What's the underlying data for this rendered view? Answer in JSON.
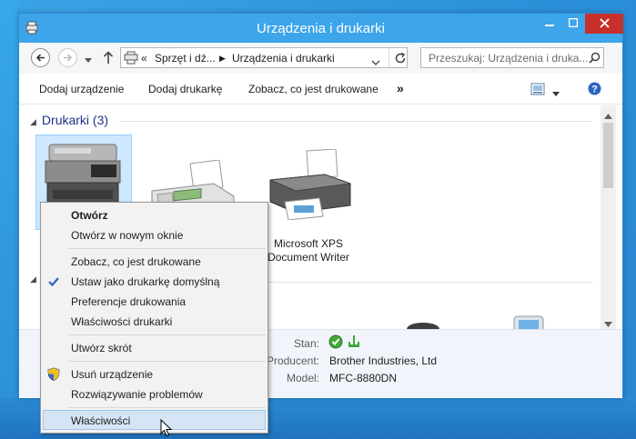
{
  "window": {
    "title": "Urządzenia i drukarki"
  },
  "address": {
    "overflow": "«",
    "segment1": "Sprzęt i dź...",
    "segment2": "Urządzenia i drukarki"
  },
  "search": {
    "placeholder": "Przeszukaj: Urządzenia i druka..."
  },
  "commands": {
    "add_device": "Dodaj urządzenie",
    "add_printer": "Dodaj drukarkę",
    "see_printing": "Zobacz, co jest drukowane",
    "more": "»"
  },
  "group": {
    "printers_header": "Drukarki (3)"
  },
  "devices": {
    "xps_label_line1": "Microsoft XPS",
    "xps_label_line2": "Document Writer"
  },
  "details": {
    "status_label": "Stan:",
    "manufacturer_label": "Producent:",
    "manufacturer_value": "Brother Industries, Ltd",
    "model_label": "Model:",
    "model_value": "MFC-8880DN"
  },
  "context_menu": {
    "open": "Otwórz",
    "open_new_window": "Otwórz w nowym oknie",
    "see_printing": "Zobacz, co jest drukowane",
    "set_default": "Ustaw jako drukarkę domyślną",
    "preferences": "Preferencje drukowania",
    "printer_properties": "Właściwości drukarki",
    "create_shortcut": "Utwórz skrót",
    "remove_device": "Usuń urządzenie",
    "troubleshoot": "Rozwiązywanie problemów",
    "properties": "Właściwości"
  },
  "colors": {
    "titlebar": "#3da5ea",
    "close": "#c7302b",
    "selection": "#cde8ff",
    "group_header": "#1e3287"
  }
}
